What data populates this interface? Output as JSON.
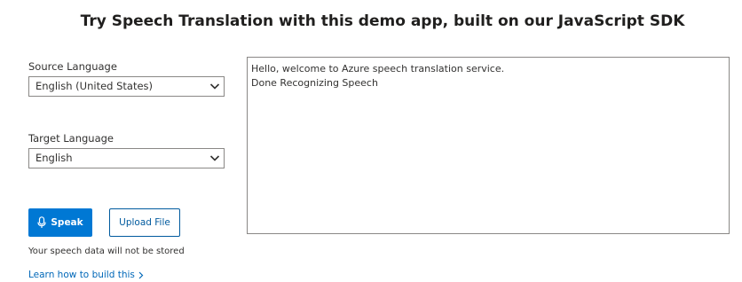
{
  "header": {
    "title": "Try Speech Translation with this demo app, built on our JavaScript SDK"
  },
  "source": {
    "label": "Source Language",
    "selected": "English (United States)"
  },
  "target": {
    "label": "Target Language",
    "selected": "English"
  },
  "actions": {
    "speak_label": "Speak",
    "upload_label": "Upload File"
  },
  "note": "Your speech data will not be stored",
  "learn_link": "Learn how to build this",
  "output": {
    "lines": [
      "Hello, welcome to Azure speech translation service.",
      "Done Recognizing Speech"
    ]
  },
  "colors": {
    "primary": "#0078d4",
    "link": "#0067b8",
    "border": "#8a8886"
  },
  "icons": {
    "speak": "microphone-icon",
    "dropdown": "chevron-down-icon",
    "link": "chevron-right-icon"
  }
}
